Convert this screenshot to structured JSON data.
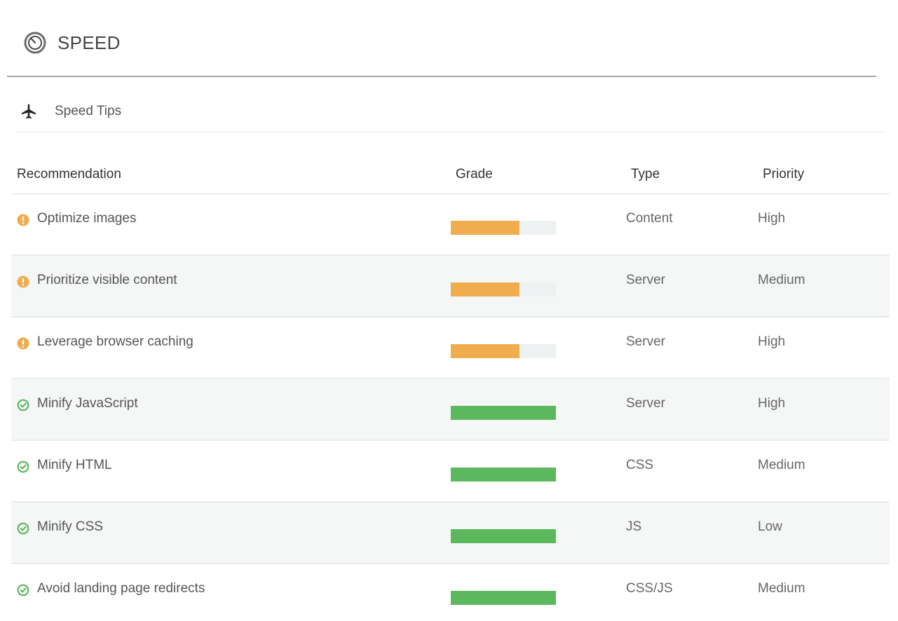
{
  "header": {
    "title": "SPEED",
    "icon": "speedometer-icon"
  },
  "section": {
    "title": "Speed Tips",
    "icon": "airplane-icon"
  },
  "colors": {
    "warning": "#f0ad4e",
    "success": "#5cb85c",
    "bar_track": "#eef1f1"
  },
  "table": {
    "columns": [
      "Recommendation",
      "Grade",
      "Type",
      "Priority"
    ],
    "rows": [
      {
        "recommendation": "Optimize images",
        "status": "warning",
        "grade_fill": 0.65,
        "type": "Content",
        "priority": "High"
      },
      {
        "recommendation": "Prioritize visible content",
        "status": "warning",
        "grade_fill": 0.65,
        "type": "Server",
        "priority": "Medium"
      },
      {
        "recommendation": "Leverage browser caching",
        "status": "warning",
        "grade_fill": 0.65,
        "type": "Server",
        "priority": "High"
      },
      {
        "recommendation": "Minify JavaScript",
        "status": "success",
        "grade_fill": 1.0,
        "type": "Server",
        "priority": "High"
      },
      {
        "recommendation": "Minify HTML",
        "status": "success",
        "grade_fill": 1.0,
        "type": "CSS",
        "priority": "Medium"
      },
      {
        "recommendation": "Minify CSS",
        "status": "success",
        "grade_fill": 1.0,
        "type": "JS",
        "priority": "Low"
      },
      {
        "recommendation": "Avoid landing page redirects",
        "status": "success",
        "grade_fill": 1.0,
        "type": "CSS/JS",
        "priority": "Medium"
      }
    ]
  }
}
